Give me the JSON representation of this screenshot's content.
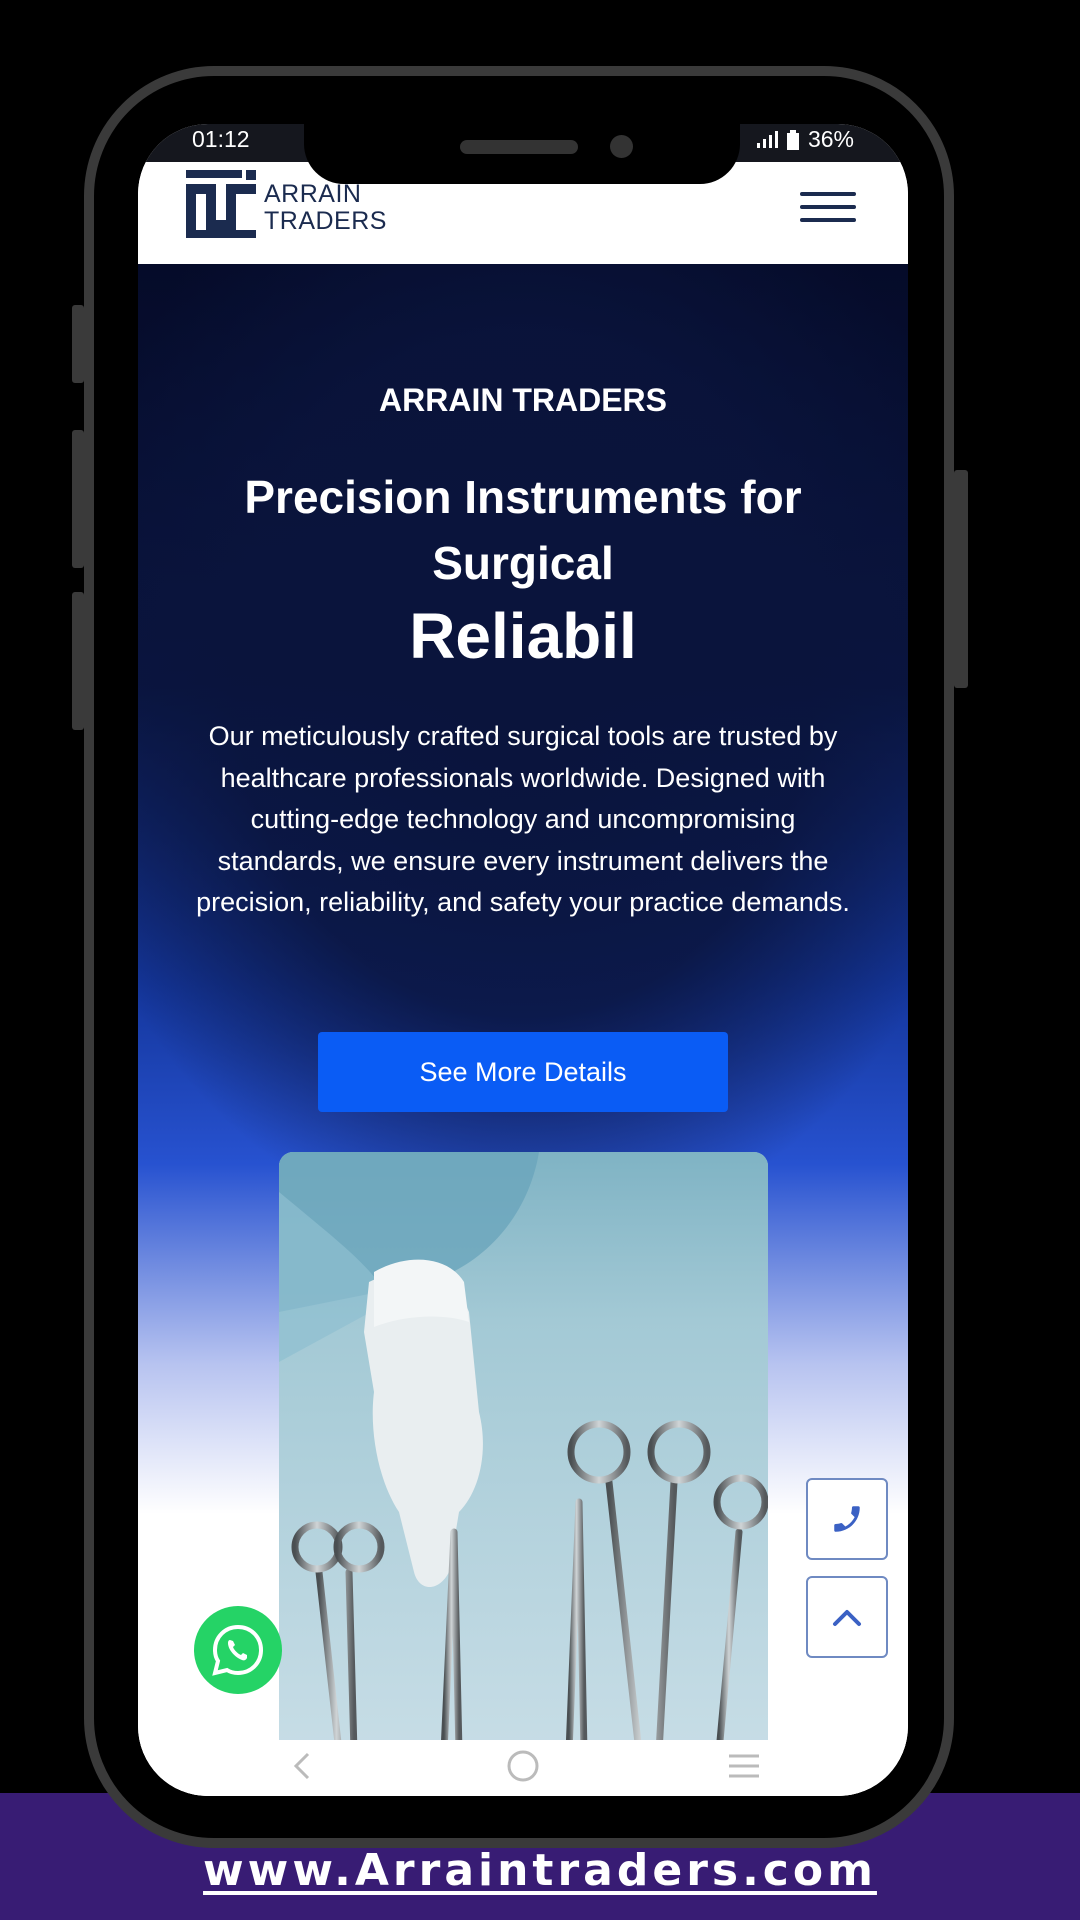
{
  "status_bar": {
    "time": "01:12",
    "battery": "36%"
  },
  "header": {
    "logo_line1": "ARRAIN",
    "logo_line2": "TRADERS",
    "menu_icon": "hamburger-menu-icon"
  },
  "hero": {
    "brand": "ARRAIN TRADERS",
    "headline_line1": "Precision Instruments for Surgical",
    "headline_line2": "Reliabil",
    "description": "Our meticulously crafted surgical tools are trusted by healthcare professionals worldwide. Designed with cutting-edge technology and uncompromising standards, we ensure every instrument delivers the precision, reliability, and safety your practice demands.",
    "cta_label": "See More Details",
    "image_icon": "surgical-instruments-photo"
  },
  "floating": {
    "phone_icon": "phone-icon",
    "scroll_top_icon": "chevron-up-icon",
    "whatsapp_icon": "whatsapp-icon"
  },
  "footer": {
    "site_url": "www.Arraintraders.com"
  },
  "colors": {
    "navy": "#0a1540",
    "cta_blue": "#0a5cf5",
    "brand_purple": "#381c74",
    "whatsapp_green": "#25d366"
  }
}
